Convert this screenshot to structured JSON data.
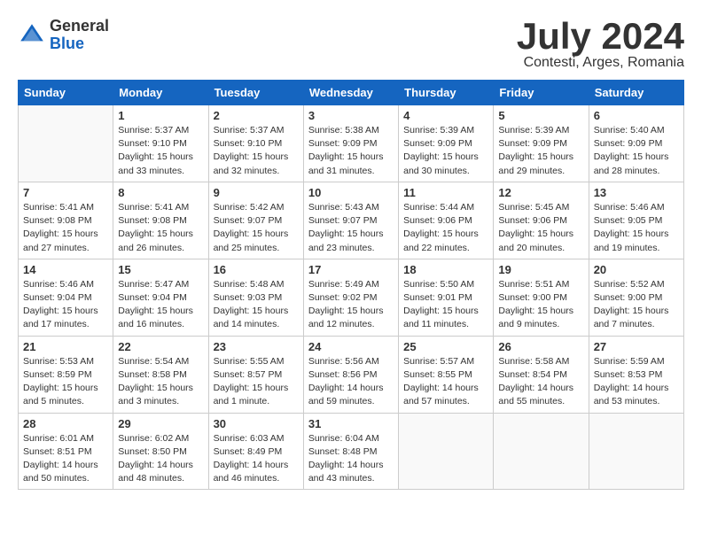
{
  "header": {
    "logo_general": "General",
    "logo_blue": "Blue",
    "month_year": "July 2024",
    "location": "Contesti, Arges, Romania"
  },
  "days_of_week": [
    "Sunday",
    "Monday",
    "Tuesday",
    "Wednesday",
    "Thursday",
    "Friday",
    "Saturday"
  ],
  "weeks": [
    [
      {
        "day": "",
        "text": ""
      },
      {
        "day": "1",
        "text": "Sunrise: 5:37 AM\nSunset: 9:10 PM\nDaylight: 15 hours\nand 33 minutes."
      },
      {
        "day": "2",
        "text": "Sunrise: 5:37 AM\nSunset: 9:10 PM\nDaylight: 15 hours\nand 32 minutes."
      },
      {
        "day": "3",
        "text": "Sunrise: 5:38 AM\nSunset: 9:09 PM\nDaylight: 15 hours\nand 31 minutes."
      },
      {
        "day": "4",
        "text": "Sunrise: 5:39 AM\nSunset: 9:09 PM\nDaylight: 15 hours\nand 30 minutes."
      },
      {
        "day": "5",
        "text": "Sunrise: 5:39 AM\nSunset: 9:09 PM\nDaylight: 15 hours\nand 29 minutes."
      },
      {
        "day": "6",
        "text": "Sunrise: 5:40 AM\nSunset: 9:09 PM\nDaylight: 15 hours\nand 28 minutes."
      }
    ],
    [
      {
        "day": "7",
        "text": "Sunrise: 5:41 AM\nSunset: 9:08 PM\nDaylight: 15 hours\nand 27 minutes."
      },
      {
        "day": "8",
        "text": "Sunrise: 5:41 AM\nSunset: 9:08 PM\nDaylight: 15 hours\nand 26 minutes."
      },
      {
        "day": "9",
        "text": "Sunrise: 5:42 AM\nSunset: 9:07 PM\nDaylight: 15 hours\nand 25 minutes."
      },
      {
        "day": "10",
        "text": "Sunrise: 5:43 AM\nSunset: 9:07 PM\nDaylight: 15 hours\nand 23 minutes."
      },
      {
        "day": "11",
        "text": "Sunrise: 5:44 AM\nSunset: 9:06 PM\nDaylight: 15 hours\nand 22 minutes."
      },
      {
        "day": "12",
        "text": "Sunrise: 5:45 AM\nSunset: 9:06 PM\nDaylight: 15 hours\nand 20 minutes."
      },
      {
        "day": "13",
        "text": "Sunrise: 5:46 AM\nSunset: 9:05 PM\nDaylight: 15 hours\nand 19 minutes."
      }
    ],
    [
      {
        "day": "14",
        "text": "Sunrise: 5:46 AM\nSunset: 9:04 PM\nDaylight: 15 hours\nand 17 minutes."
      },
      {
        "day": "15",
        "text": "Sunrise: 5:47 AM\nSunset: 9:04 PM\nDaylight: 15 hours\nand 16 minutes."
      },
      {
        "day": "16",
        "text": "Sunrise: 5:48 AM\nSunset: 9:03 PM\nDaylight: 15 hours\nand 14 minutes."
      },
      {
        "day": "17",
        "text": "Sunrise: 5:49 AM\nSunset: 9:02 PM\nDaylight: 15 hours\nand 12 minutes."
      },
      {
        "day": "18",
        "text": "Sunrise: 5:50 AM\nSunset: 9:01 PM\nDaylight: 15 hours\nand 11 minutes."
      },
      {
        "day": "19",
        "text": "Sunrise: 5:51 AM\nSunset: 9:00 PM\nDaylight: 15 hours\nand 9 minutes."
      },
      {
        "day": "20",
        "text": "Sunrise: 5:52 AM\nSunset: 9:00 PM\nDaylight: 15 hours\nand 7 minutes."
      }
    ],
    [
      {
        "day": "21",
        "text": "Sunrise: 5:53 AM\nSunset: 8:59 PM\nDaylight: 15 hours\nand 5 minutes."
      },
      {
        "day": "22",
        "text": "Sunrise: 5:54 AM\nSunset: 8:58 PM\nDaylight: 15 hours\nand 3 minutes."
      },
      {
        "day": "23",
        "text": "Sunrise: 5:55 AM\nSunset: 8:57 PM\nDaylight: 15 hours\nand 1 minute."
      },
      {
        "day": "24",
        "text": "Sunrise: 5:56 AM\nSunset: 8:56 PM\nDaylight: 14 hours\nand 59 minutes."
      },
      {
        "day": "25",
        "text": "Sunrise: 5:57 AM\nSunset: 8:55 PM\nDaylight: 14 hours\nand 57 minutes."
      },
      {
        "day": "26",
        "text": "Sunrise: 5:58 AM\nSunset: 8:54 PM\nDaylight: 14 hours\nand 55 minutes."
      },
      {
        "day": "27",
        "text": "Sunrise: 5:59 AM\nSunset: 8:53 PM\nDaylight: 14 hours\nand 53 minutes."
      }
    ],
    [
      {
        "day": "28",
        "text": "Sunrise: 6:01 AM\nSunset: 8:51 PM\nDaylight: 14 hours\nand 50 minutes."
      },
      {
        "day": "29",
        "text": "Sunrise: 6:02 AM\nSunset: 8:50 PM\nDaylight: 14 hours\nand 48 minutes."
      },
      {
        "day": "30",
        "text": "Sunrise: 6:03 AM\nSunset: 8:49 PM\nDaylight: 14 hours\nand 46 minutes."
      },
      {
        "day": "31",
        "text": "Sunrise: 6:04 AM\nSunset: 8:48 PM\nDaylight: 14 hours\nand 43 minutes."
      },
      {
        "day": "",
        "text": ""
      },
      {
        "day": "",
        "text": ""
      },
      {
        "day": "",
        "text": ""
      }
    ]
  ]
}
